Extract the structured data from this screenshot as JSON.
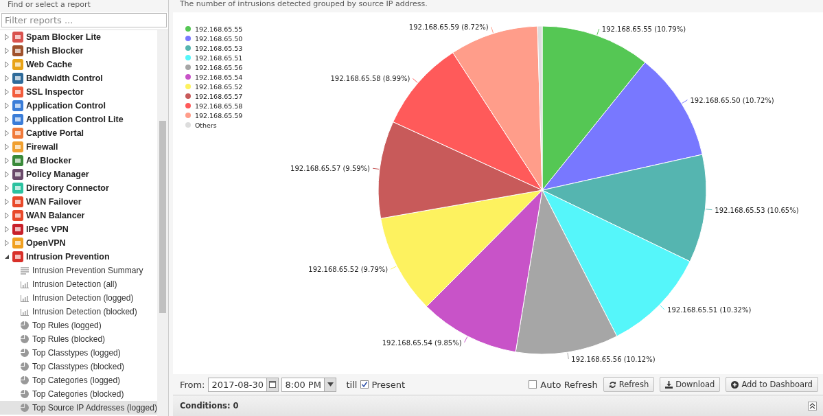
{
  "sidebar": {
    "title": "Find or select a report",
    "filter": {
      "placeholder": "Filter reports ..."
    },
    "items": [
      {
        "label": "Spam Blocker Lite",
        "color": "#d9534f",
        "expanded": false
      },
      {
        "label": "Phish Blocker",
        "color": "#a0522d",
        "expanded": false
      },
      {
        "label": "Web Cache",
        "color": "#e8a317",
        "expanded": false
      },
      {
        "label": "Bandwidth Control",
        "color": "#2f6b9a",
        "expanded": false
      },
      {
        "label": "SSL Inspector",
        "color": "#f25c3c",
        "expanded": false
      },
      {
        "label": "Application Control",
        "color": "#3b7dd8",
        "expanded": false
      },
      {
        "label": "Application Control Lite",
        "color": "#3b7dd8",
        "expanded": false
      },
      {
        "label": "Captive Portal",
        "color": "#f07a3a",
        "expanded": false
      },
      {
        "label": "Firewall",
        "color": "#f0a030",
        "expanded": false
      },
      {
        "label": "Ad Blocker",
        "color": "#3a8a3a",
        "expanded": false
      },
      {
        "label": "Policy Manager",
        "color": "#6a4a6a",
        "expanded": false
      },
      {
        "label": "Directory Connector",
        "color": "#2bc2a0",
        "expanded": false
      },
      {
        "label": "WAN Failover",
        "color": "#e8492a",
        "expanded": false
      },
      {
        "label": "WAN Balancer",
        "color": "#e8492a",
        "expanded": false
      },
      {
        "label": "IPsec VPN",
        "color": "#c8202a",
        "expanded": false
      },
      {
        "label": "OpenVPN",
        "color": "#f0a020",
        "expanded": false
      },
      {
        "label": "Intrusion Prevention",
        "color": "#d8302a",
        "expanded": true,
        "children": [
          {
            "label": "Intrusion Prevention Summary",
            "kind": "text",
            "selected": false
          },
          {
            "label": "Intrusion Detection (all)",
            "kind": "bar",
            "selected": false
          },
          {
            "label": "Intrusion Detection (logged)",
            "kind": "bar",
            "selected": false
          },
          {
            "label": "Intrusion Detection (blocked)",
            "kind": "bar",
            "selected": false
          },
          {
            "label": "Top Rules (logged)",
            "kind": "pie",
            "selected": false
          },
          {
            "label": "Top Rules (blocked)",
            "kind": "pie",
            "selected": false
          },
          {
            "label": "Top Classtypes (logged)",
            "kind": "pie",
            "selected": false
          },
          {
            "label": "Top Classtypes (blocked)",
            "kind": "pie",
            "selected": false
          },
          {
            "label": "Top Categories (logged)",
            "kind": "pie",
            "selected": false
          },
          {
            "label": "Top Categories (blocked)",
            "kind": "pie",
            "selected": false
          },
          {
            "label": "Top Source IP Addresses (logged)",
            "kind": "pie",
            "selected": true
          }
        ]
      }
    ]
  },
  "report": {
    "description": "The number of intrusions detected grouped by source IP address.",
    "chart_data": {
      "type": "pie",
      "categories": [
        "192.168.65.55",
        "192.168.65.50",
        "192.168.65.53",
        "192.168.65.51",
        "192.168.65.56",
        "192.168.65.54",
        "192.168.65.52",
        "192.168.65.57",
        "192.168.65.58",
        "192.168.65.59",
        "Others"
      ],
      "values": [
        10.79,
        10.72,
        10.65,
        10.32,
        10.12,
        9.85,
        9.79,
        9.59,
        8.99,
        8.72,
        0.46
      ],
      "legend": true,
      "colors": [
        "#55c754",
        "#7878ff",
        "#55b5b0",
        "#55f6fa",
        "#a6a6a6",
        "#c853c8",
        "#fdf25f",
        "#c85a5a",
        "#ff5a5a",
        "#ff9d8a",
        "#dddddd"
      ],
      "value_labels": [
        "192.168.65.55 (10.79%)",
        "192.168.65.50 (10.72%)",
        "192.168.65.53 (10.65%)",
        "192.168.65.51 (10.32%)",
        "192.168.65.56 (10.12%)",
        "192.168.65.54 (9.85%)",
        "192.168.65.52 (9.79%)",
        "192.168.65.57 (9.59%)",
        "192.168.65.58 (8.99%)",
        "192.168.65.59 (8.72%)",
        null
      ]
    }
  },
  "toolbar": {
    "from_label": "From:",
    "date": "2017-08-30",
    "time": "8:00 PM",
    "till_label": "till",
    "present": {
      "label": "Present",
      "checked": true
    },
    "auto_refresh": {
      "label": "Auto Refresh",
      "checked": false
    },
    "buttons": [
      {
        "kind": "refresh",
        "label": "Refresh"
      },
      {
        "kind": "download",
        "label": "Download"
      },
      {
        "kind": "add",
        "label": "Add to Dashboard"
      }
    ]
  },
  "conditions": {
    "label": "Conditions: 0"
  }
}
